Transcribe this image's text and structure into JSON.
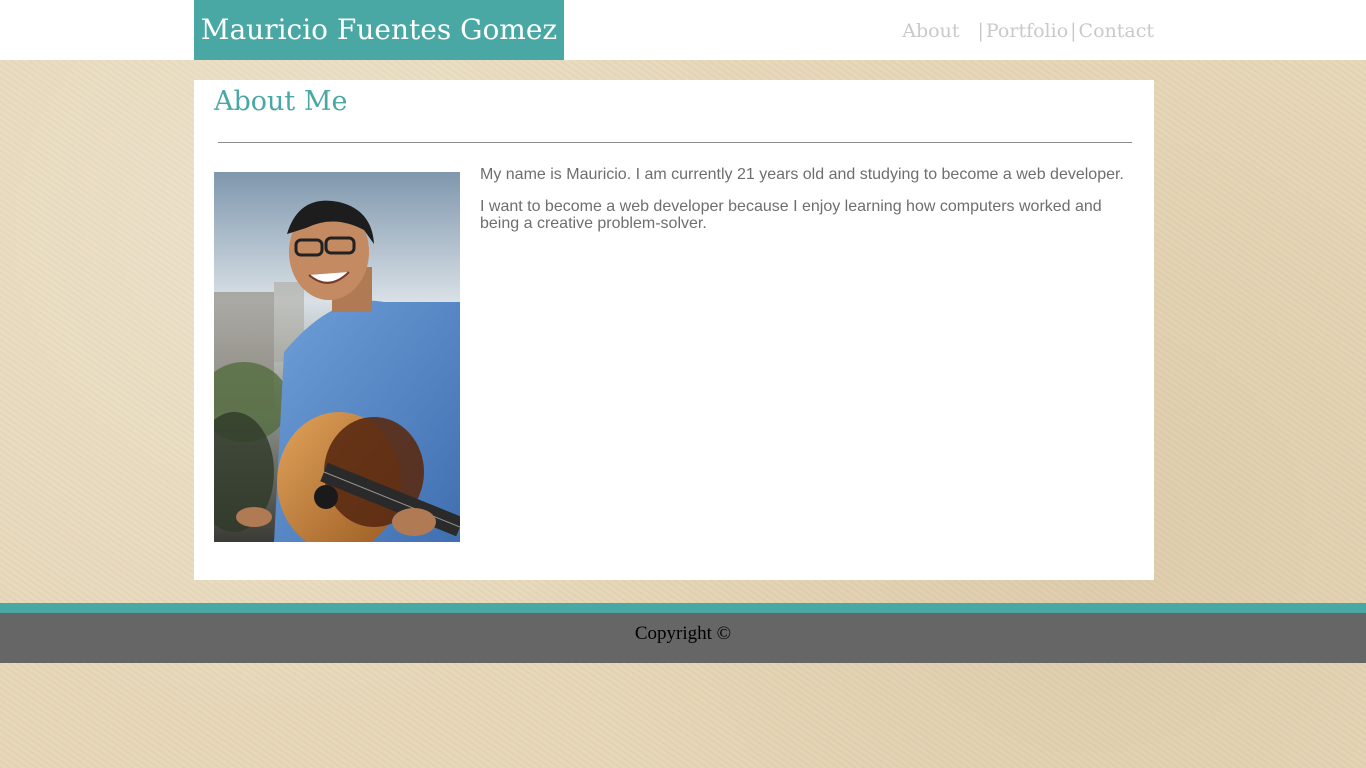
{
  "header": {
    "brand": "Mauricio Fuentes Gomez",
    "nav": {
      "about": "About",
      "portfolio": "Portfolio",
      "contact": "Contact",
      "separator": "|"
    }
  },
  "main": {
    "title": "About Me",
    "bio": [
      "My name is Mauricio. I am currently 21 years old and studying to become a web developer.",
      "I want to become a web developer because I enjoy learning how computers worked and being a creative problem-solver."
    ]
  },
  "footer": {
    "text": "Copyright ©"
  },
  "colors": {
    "accent": "#4aa8a4",
    "footer_bg": "#666666",
    "nav_text": "#c9c9c9",
    "body_text": "#6e6e6e"
  }
}
